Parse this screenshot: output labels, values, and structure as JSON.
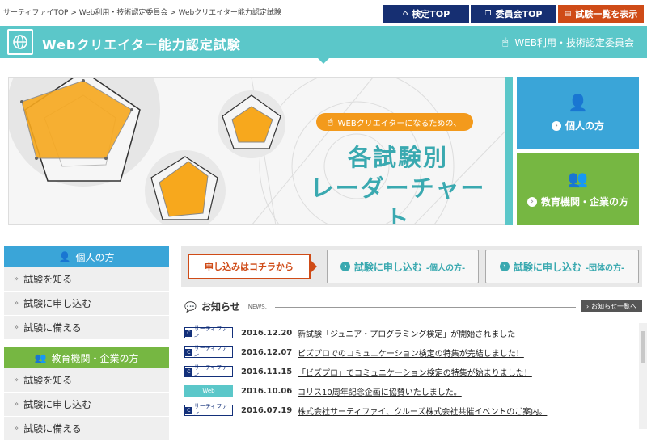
{
  "breadcrumb": [
    "サーティファイTOP",
    "Web利用・技術認定委員会",
    "Webクリエイター能力認定試験"
  ],
  "top_buttons": {
    "kentei_top": "検定TOP",
    "iinkai_top": "委員会TOP",
    "exam_list": "試験一覧を表示"
  },
  "header": {
    "title": "Webクリエイター能力認定試験",
    "committee": "WEB利用・技術認定委員会"
  },
  "hero": {
    "tagline": "WEBクリエイターになるための、",
    "line1": "各試験別",
    "line2": "レーダーチャート"
  },
  "side_buttons": {
    "individual": "個人の方",
    "org": "教育機関・企業の方"
  },
  "left_nav": {
    "individual_head": "個人の方",
    "org_head": "教育機関・企業の方",
    "individual_items": [
      "試験を知る",
      "試験に申し込む",
      "試験に備える"
    ],
    "org_items": [
      "試験を知る",
      "試験に申し込む",
      "試験に備える"
    ]
  },
  "apply": {
    "label": "申し込みはコチラから",
    "individual_main": "試験に申し込む",
    "individual_sub": "-個人の方-",
    "group_main": "試験に申し込む",
    "group_sub": "-団体の方-"
  },
  "news": {
    "title": "お知らせ",
    "title_en": "NEWS.",
    "all_link": "お知らせ一覧へ",
    "items": [
      {
        "badge": "サーティファイ",
        "badge_type": "certify",
        "date": "2016.12.20",
        "text": "新試験「ジュニア・プログラミング検定」が開始されました"
      },
      {
        "badge": "サーティファイ",
        "badge_type": "certify",
        "date": "2016.12.07",
        "text": "ビズプロでのコミュニケーション検定の特集が完結しました！"
      },
      {
        "badge": "サーティファイ",
        "badge_type": "certify",
        "date": "2016.11.15",
        "text": "「ビズプロ」でコミュニケーション検定の特集が始まりました！"
      },
      {
        "badge": "Web",
        "badge_type": "web",
        "date": "2016.10.06",
        "text": "コリス10周年記念企画に協賛いたしました。"
      },
      {
        "badge": "サーティファイ",
        "badge_type": "certify",
        "date": "2016.07.19",
        "text": "株式会社サーティファイ、クルーズ株式会社共催イベントのご案内。"
      }
    ]
  },
  "colors": {
    "teal": "#5bc7c9",
    "navy": "#162f72",
    "red": "#cf4b17",
    "blue": "#3aa5d8",
    "green": "#76b742",
    "orange": "#f39a1c"
  }
}
